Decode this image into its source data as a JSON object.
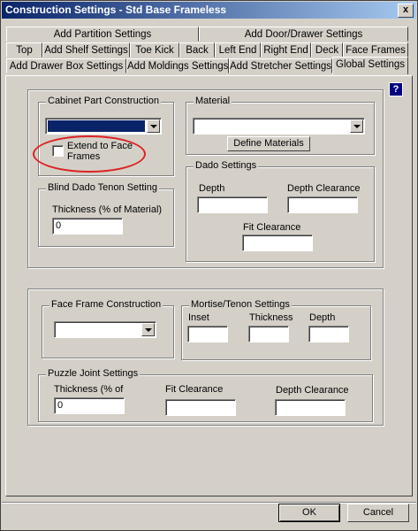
{
  "window": {
    "title": "Construction Settings - Std Base Frameless",
    "close_label": "x"
  },
  "tabs": [
    {
      "label": "Add Partition Settings"
    },
    {
      "label": "Add Door/Drawer Settings"
    },
    {
      "label": "Top"
    },
    {
      "label": "Add Shelf Settings"
    },
    {
      "label": "Toe Kick"
    },
    {
      "label": "Back"
    },
    {
      "label": "Left End"
    },
    {
      "label": "Right End"
    },
    {
      "label": "Deck"
    },
    {
      "label": "Face Frames"
    },
    {
      "label": "Add Drawer Box Settings"
    },
    {
      "label": "Add Moldings Settings"
    },
    {
      "label": "Add Stretcher Settings"
    },
    {
      "label": "Global Settings",
      "active": true
    }
  ],
  "help_label": "?",
  "cabinet_part": {
    "legend": "Cabinet Part Construction",
    "selected_value": "",
    "extend_label": "Extend to Face Frames",
    "extend_checked": false
  },
  "material": {
    "legend": "Material",
    "selected_value": "",
    "define_button": "Define Materials"
  },
  "dado": {
    "legend": "Dado Settings",
    "depth_label": "Depth",
    "depth_value": "",
    "depth_clearance_label": "Depth Clearance",
    "depth_clearance_value": "",
    "fit_clearance_label": "Fit Clearance",
    "fit_clearance_value": ""
  },
  "blind_dado": {
    "legend": "Blind Dado Tenon Setting",
    "thickness_label": "Thickness (% of Material)",
    "thickness_value": "0"
  },
  "face_frame": {
    "legend": "Face Frame Construction",
    "selected_value": ""
  },
  "mortise": {
    "legend": "Mortise/Tenon Settings",
    "inset_label": "Inset",
    "inset_value": "",
    "thickness_label": "Thickness",
    "thickness_value": "",
    "depth_label": "Depth",
    "depth_value": ""
  },
  "puzzle": {
    "legend": "Puzzle Joint Settings",
    "thickness_label": "Thickness (% of",
    "thickness_value": "0",
    "fit_clearance_label": "Fit Clearance",
    "fit_clearance_value": "",
    "depth_clearance_label": "Depth Clearance",
    "depth_clearance_value": ""
  },
  "footer": {
    "ok_label": "OK",
    "cancel_label": "Cancel"
  },
  "annotation_color": "#dd2222"
}
